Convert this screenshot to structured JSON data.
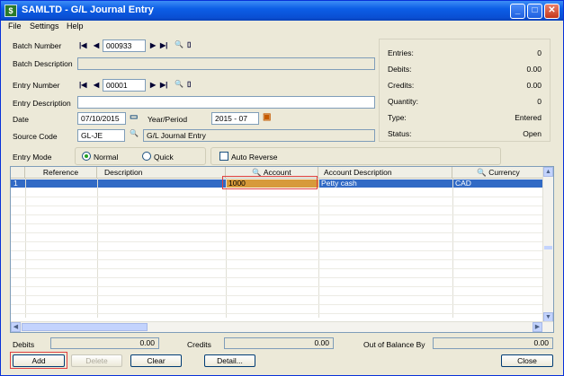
{
  "window": {
    "title": "SAMLTD - G/L Journal Entry",
    "min": "_",
    "max": "□",
    "close": "✕"
  },
  "menu": {
    "file": "File",
    "settings": "Settings",
    "help": "Help"
  },
  "batch": {
    "number_label": "Batch Number",
    "number": "000933",
    "desc_label": "Batch Description",
    "desc": ""
  },
  "entry": {
    "number_label": "Entry Number",
    "number": "00001",
    "desc_label": "Entry Description",
    "desc": "",
    "date_label": "Date",
    "date": "07/10/2015",
    "yp_label": "Year/Period",
    "year_period": "2015 - 07",
    "src_label": "Source Code",
    "source_code": "GL-JE",
    "source_desc": "G/L Journal Entry",
    "mode_label": "Entry Mode",
    "mode_normal": "Normal",
    "mode_quick": "Quick",
    "auto_reverse": "Auto Reverse"
  },
  "summary": [
    {
      "label": "Entries:",
      "value": "0"
    },
    {
      "label": "Debits:",
      "value": "0.00"
    },
    {
      "label": "Credits:",
      "value": "0.00"
    },
    {
      "label": "Quantity:",
      "value": "0"
    },
    {
      "label": "Type:",
      "value": "Entered"
    },
    {
      "label": "Status:",
      "value": "Open"
    }
  ],
  "grid": {
    "headers": {
      "reference": "Reference",
      "description": "Description",
      "account": "Account",
      "account_desc": "Account Description",
      "currency": "Currency"
    },
    "rows": [
      {
        "num": "1",
        "reference": "",
        "description": "",
        "account": "1000",
        "account_desc": "Petty cash",
        "currency": "CAD"
      }
    ]
  },
  "totals": {
    "debits_label": "Debits",
    "debits": "0.00",
    "credits_label": "Credits",
    "credits": "0.00",
    "oob_label": "Out of Balance By",
    "oob": "0.00"
  },
  "buttons": {
    "add": "Add",
    "delete": "Delete",
    "clear": "Clear",
    "detail": "Detail...",
    "close": "Close"
  },
  "colors": {
    "title_bar": "#0a4fd3",
    "row_select": "#316ac5",
    "account_cell": "#d79a3a",
    "highlight_box": "#e04040"
  }
}
